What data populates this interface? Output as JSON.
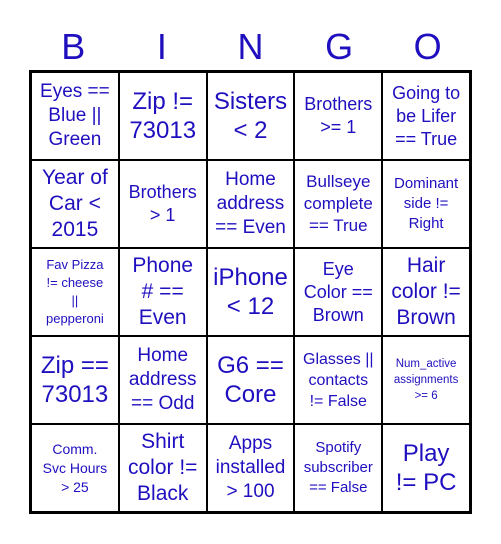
{
  "header": {
    "letters": [
      "B",
      "I",
      "N",
      "G",
      "O"
    ]
  },
  "colors": {
    "text": "#1f0fbf",
    "grid": "#000000",
    "background": "#ffffff"
  },
  "cells": [
    [
      "Eyes ==\nBlue ||\nGreen",
      "Zip !=\n73013",
      "Sisters\n< 2",
      "Brothers\n>= 1",
      "Going to\nbe Lifer\n== True"
    ],
    [
      "Year of\nCar <\n2015",
      "Brothers\n> 1",
      "Home\naddress\n== Even",
      "Bullseye\ncomplete\n== True",
      "Dominant\nside !=\nRight"
    ],
    [
      "Fav Pizza\n!= cheese\n||\npepperoni",
      "Phone\n# ==\nEven",
      "iPhone\n< 12",
      "Eye\nColor ==\nBrown",
      "Hair\ncolor !=\nBrown"
    ],
    [
      "Zip ==\n73013",
      "Home\naddress\n== Odd",
      "G6 ==\nCore",
      "Glasses ||\ncontacts\n!= False",
      "Num_active\nassignments\n>= 6"
    ],
    [
      "Comm.\nSvc Hours\n> 25",
      "Shirt\ncolor !=\nBlack",
      "Apps\ninstalled\n> 100",
      "Spotify\nsubscriber\n== False",
      "Play\n!= PC"
    ]
  ]
}
